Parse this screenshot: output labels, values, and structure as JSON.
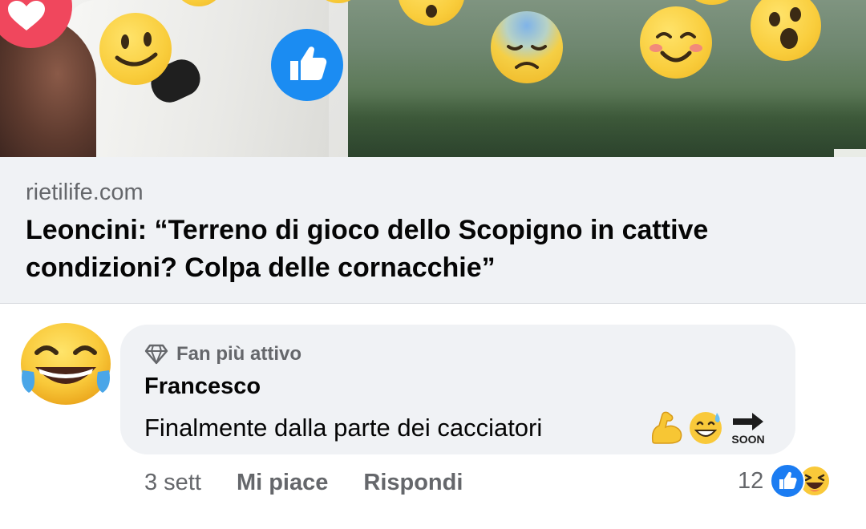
{
  "preview": {
    "domain": "rietilife.com",
    "title": "Leoncini: “Terreno di gioco dello Scopigno in cattive condizioni? Colpa delle cornacchie”"
  },
  "comment": {
    "badge": "Fan più attivo",
    "author": "Francesco",
    "text": "Finalmente dalla parte dei cacciatori",
    "emojis": [
      "flexed-biceps",
      "grinning-sweat",
      "soon-arrow"
    ]
  },
  "actions": {
    "timestamp": "3 sett",
    "like_label": "Mi piace",
    "reply_label": "Rispondi",
    "reaction_count": "12",
    "reactions": [
      "like",
      "haha"
    ]
  },
  "colors": {
    "like_blue": "#1b7cf2",
    "love_red": "#f0475d",
    "bubble_bg": "#f0f2f5",
    "secondary_text": "#65676b"
  }
}
